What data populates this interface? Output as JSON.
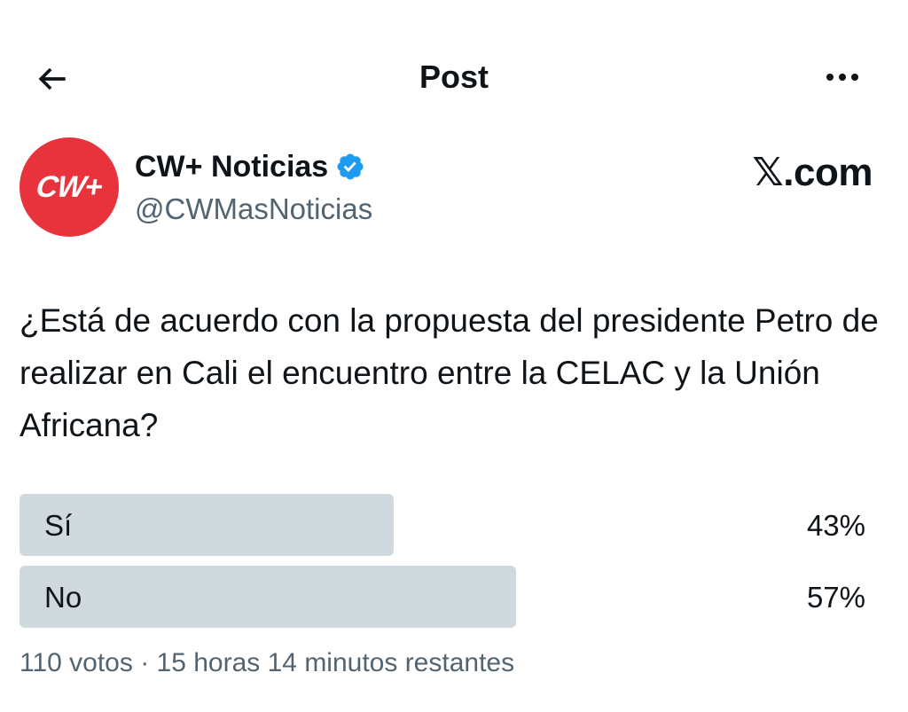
{
  "header": {
    "title": "Post",
    "back_icon": "arrow-left-icon",
    "more_icon": "more-horizontal-icon"
  },
  "author": {
    "avatar_text": "CW+",
    "avatar_color": "#e8333c",
    "name": "CW+ Noticias",
    "verified_icon": "verified-badge-icon",
    "verified_color": "#1d9bf0",
    "handle": "@CWMasNoticias"
  },
  "watermark": "𝕏.com",
  "question": "¿Está de acuerdo con la propuesta del presidente Petro de realizar en Cali el encuentro entre la CELAC y la Unión Africana?",
  "poll": {
    "options": [
      {
        "label": "Sí",
        "percent_text": "43%",
        "percent": 43
      },
      {
        "label": "No",
        "percent_text": "57%",
        "percent": 57
      }
    ],
    "bar_color": "#cfd9de",
    "footer": "110 votos · 15 horas 14 minutos restantes"
  }
}
